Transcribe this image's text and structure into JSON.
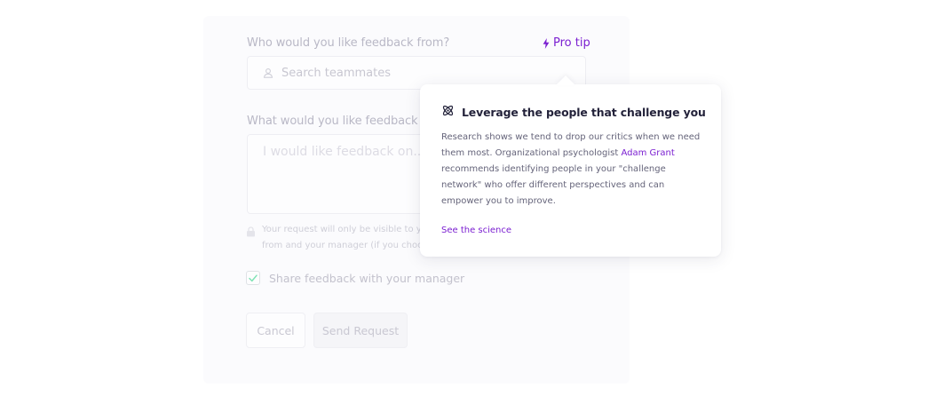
{
  "form": {
    "who_label": "Who would you like feedback from?",
    "pro_tip_label": "Pro tip",
    "search_placeholder": "Search teammates",
    "what_label": "What would you like feedback ab",
    "feedback_placeholder": "I would like feedback on...",
    "privacy_text_line1": "Your request will only be visible to yo",
    "privacy_text_line2": "from and your manager (if you choo",
    "share_label": "Share feedback with your manager",
    "share_checked": true,
    "cancel_label": "Cancel",
    "send_label": "Send Request"
  },
  "popover": {
    "icon": "atom-icon",
    "title": "Leverage the people that challenge you",
    "body_before": "Research shows we tend to drop our critics when we need them most. Organizational psychologist ",
    "body_link": "Adam Grant",
    "body_after": " recommends identifying people in your \"challenge network\" who offer different perspectives and can empower you to improve.",
    "cta_label": "See the science"
  },
  "colors": {
    "accent": "#7b1fd1",
    "title": "#23223a",
    "body": "#65647a",
    "check": "#3ecf8e",
    "faded_text": "#c3c2cd"
  }
}
